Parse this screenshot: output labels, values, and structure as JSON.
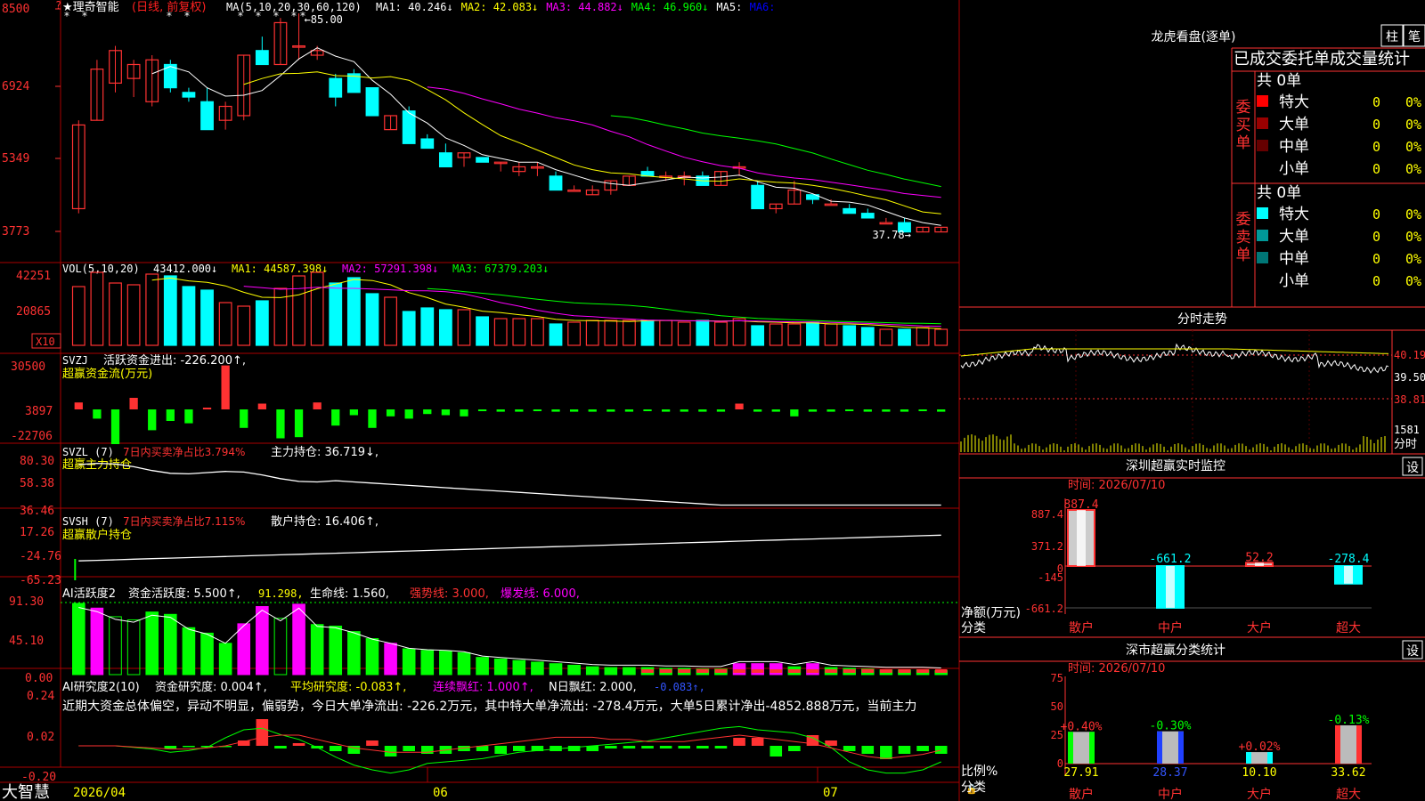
{
  "header": {
    "stock_name": "★理奇智能",
    "period_tag": "(日线, 前复权)",
    "ma_prefix": "MA(5,10,20,30,60,120)",
    "ma_items": [
      {
        "label": "MA1: 40.246↓",
        "color": "#ffffff"
      },
      {
        "label": "MA2: 42.083↓",
        "color": "#ffff00"
      },
      {
        "label": "MA3: 44.882↓",
        "color": "#ff00ff"
      },
      {
        "label": "MA4: 46.960↓",
        "color": "#00ff00"
      },
      {
        "label": "MA5:",
        "color": "#ffffff"
      },
      {
        "label": "MA6:",
        "color": "#0000ff"
      }
    ],
    "high_mark": "85.00",
    "low_mark": "37.78→"
  },
  "main_axis": [
    "8500",
    "6924",
    "5349",
    "3773"
  ],
  "vol": {
    "prefix": "VOL(5,10,20)",
    "value": "43412.000↓",
    "ma1": "MA1: 44587.398↓",
    "ma2": "MA2: 57291.398↓",
    "ma3": "MA3: 67379.203↓",
    "axis": [
      "42251",
      "20865"
    ],
    "unit": "X10"
  },
  "svzj": {
    "prefix": "SVZJ",
    "label": "活跃资金进出: -226.200↑,",
    "sub": "超赢资金流(万元)",
    "axis": [
      "30500",
      "3897",
      "-22706"
    ]
  },
  "svzl": {
    "prefix": "SVZL (7)",
    "label1": "7日内买卖净占比3.794%",
    "label2": "主力持仓: 36.719↓,",
    "sub": "超赢主力持仓",
    "axis": [
      "80.30",
      "58.38",
      "36.46"
    ]
  },
  "svsh": {
    "prefix": "SVSH (7)",
    "label1": "7日内买卖净占比7.115%",
    "label2": "散户持仓: 16.406↑,",
    "sub": "超赢散户持仓",
    "axis": [
      "17.26",
      "-24.76",
      "-65.23"
    ]
  },
  "ai1": {
    "prefix": "AI活跃度2",
    "label1": "资金活跃度: 5.500↑,",
    "label2": "91.298,",
    "label3": "生命线: 1.560,",
    "label4": "强势线: 3.000,",
    "label5": "爆发线: 6.000,",
    "axis": [
      "91.30",
      "45.10",
      "0.00"
    ]
  },
  "ai2": {
    "prefix": "AI研究度2(10)",
    "label1": "资金研究度: 0.004↑,",
    "label2": "平均研究度: -0.083↑,",
    "label3": "连续飘红: 1.000↑,",
    "label4": "N日飘红: 2.000,",
    "label5": "-0.083↑,",
    "commentary": "近期大资金总体偏空，异动不明显，偏弱势，今日大单净流出: -226.2万元，其中特大单净流出: -278.4万元，大单5日累计净出-4852.888万元，当前主力",
    "axis": [
      "0.24",
      "0.02",
      "-0.20"
    ]
  },
  "bottom_bar": {
    "brand": "大智慧",
    "dates": [
      "2026/04",
      "06",
      "07"
    ]
  },
  "right": {
    "title": "龙虎看盘(逐单)",
    "tab1": "柱",
    "tab2": "笔",
    "table_header": "已成交委托单成交量统计",
    "buy": {
      "side_label": "委买单",
      "total": "共 0单",
      "rows": [
        {
          "name": "特大",
          "val": "0",
          "pct": "0%",
          "color": "#ff0000"
        },
        {
          "name": "大单",
          "val": "0",
          "pct": "0%",
          "color": "#990000"
        },
        {
          "name": "中单",
          "val": "0",
          "pct": "0%",
          "color": "#660000"
        },
        {
          "name": "小单",
          "val": "0",
          "pct": "0%",
          "color": "#000000"
        }
      ]
    },
    "sell": {
      "side_label": "委卖单",
      "total": "共 0单",
      "rows": [
        {
          "name": "特大",
          "val": "0",
          "pct": "0%",
          "color": "#00ffff"
        },
        {
          "name": "大单",
          "val": "0",
          "pct": "0%",
          "color": "#009999"
        },
        {
          "name": "中单",
          "val": "0",
          "pct": "0%",
          "color": "#007777"
        },
        {
          "name": "小单",
          "val": "0",
          "pct": "0%",
          "color": "#000000"
        }
      ]
    },
    "intraday": {
      "title": "分时走势",
      "axis": [
        "40.19",
        "39.50",
        "38.81"
      ],
      "vol_axis": [
        "1581"
      ],
      "vol_unit": "分时"
    },
    "monitor": {
      "title": "深圳超赢实时监控",
      "set": "设",
      "time": "时间: 2026/07/10",
      "axis": [
        "887.4",
        "371.2",
        "0",
        "-145",
        "-661.2"
      ],
      "ylabel": "净额(万元)",
      "xlabel": "分类",
      "categories": [
        "散户",
        "中户",
        "大户",
        "超大"
      ],
      "values": [
        "887.4",
        "-661.2",
        "52.2",
        "-278.4"
      ]
    },
    "classify": {
      "title": "深市超赢分类统计",
      "set": "设",
      "time": "时间: 2026/07/10",
      "axis": [
        "75",
        "50",
        "25",
        "0"
      ],
      "ylabel": "比例%",
      "xlabel": "分类",
      "categories": [
        "散户",
        "中户",
        "大户",
        "超大"
      ],
      "changes": [
        "+0.40%",
        "-0.30%",
        "+0.02%",
        "-0.13%"
      ],
      "values": [
        "27.91",
        "28.37",
        "10.10",
        "33.62"
      ]
    }
  },
  "chart_data": [
    {
      "type": "candlestick",
      "title": "★理奇智能",
      "ylabel": "",
      "ylim": [
        37.73,
        85.0
      ],
      "bars": [
        {
          "o": 43,
          "h": 62,
          "l": 42,
          "c": 61
        },
        {
          "o": 62,
          "h": 75,
          "l": 62,
          "c": 73
        },
        {
          "o": 70,
          "h": 78,
          "l": 68,
          "c": 77
        },
        {
          "o": 71,
          "h": 75,
          "l": 67,
          "c": 74
        },
        {
          "o": 66,
          "h": 76,
          "l": 65,
          "c": 75
        },
        {
          "o": 74,
          "h": 75,
          "l": 68,
          "c": 69
        },
        {
          "o": 68,
          "h": 69,
          "l": 66,
          "c": 67
        },
        {
          "o": 66,
          "h": 69,
          "l": 60,
          "c": 60
        },
        {
          "o": 62,
          "h": 66,
          "l": 60,
          "c": 65
        },
        {
          "o": 63,
          "h": 76,
          "l": 62,
          "c": 76
        },
        {
          "o": 77,
          "h": 80,
          "l": 75,
          "c": 74
        },
        {
          "o": 74,
          "h": 84,
          "l": 74,
          "c": 83
        },
        {
          "o": 78,
          "h": 85,
          "l": 75,
          "c": 78
        },
        {
          "o": 76,
          "h": 78,
          "l": 75,
          "c": 77
        },
        {
          "o": 71,
          "h": 72,
          "l": 65,
          "c": 67
        },
        {
          "o": 72,
          "h": 73,
          "l": 68,
          "c": 68
        },
        {
          "o": 69,
          "h": 69,
          "l": 63,
          "c": 63
        },
        {
          "o": 60,
          "h": 63,
          "l": 60,
          "c": 63
        },
        {
          "o": 64,
          "h": 65,
          "l": 57,
          "c": 57
        },
        {
          "o": 58,
          "h": 59,
          "l": 56,
          "c": 56
        },
        {
          "o": 55,
          "h": 57,
          "l": 52,
          "c": 52
        },
        {
          "o": 54,
          "h": 55,
          "l": 52,
          "c": 55
        },
        {
          "o": 54,
          "h": 54,
          "l": 53,
          "c": 53
        },
        {
          "o": 53,
          "h": 53,
          "l": 51,
          "c": 53
        },
        {
          "o": 51,
          "h": 53,
          "l": 50,
          "c": 52
        },
        {
          "o": 52,
          "h": 53,
          "l": 50,
          "c": 52
        },
        {
          "o": 50,
          "h": 51,
          "l": 47,
          "c": 47
        },
        {
          "o": 47,
          "h": 48,
          "l": 47,
          "c": 47
        },
        {
          "o": 46,
          "h": 48,
          "l": 46,
          "c": 47
        },
        {
          "o": 47,
          "h": 49,
          "l": 46,
          "c": 49
        },
        {
          "o": 48,
          "h": 50,
          "l": 48,
          "c": 50
        },
        {
          "o": 51,
          "h": 52,
          "l": 50,
          "c": 50
        },
        {
          "o": 50,
          "h": 51,
          "l": 49,
          "c": 50
        },
        {
          "o": 50,
          "h": 51,
          "l": 48,
          "c": 50
        },
        {
          "o": 50,
          "h": 51,
          "l": 48,
          "c": 48
        },
        {
          "o": 48,
          "h": 51,
          "l": 48,
          "c": 51
        },
        {
          "o": 52,
          "h": 53,
          "l": 50,
          "c": 52
        },
        {
          "o": 48,
          "h": 49,
          "l": 43,
          "c": 43
        },
        {
          "o": 43,
          "h": 44,
          "l": 42,
          "c": 44
        },
        {
          "o": 44,
          "h": 49,
          "l": 44,
          "c": 47
        },
        {
          "o": 46,
          "h": 46,
          "l": 44,
          "c": 45
        },
        {
          "o": 44,
          "h": 45,
          "l": 44,
          "c": 44
        },
        {
          "o": 43,
          "h": 44,
          "l": 42,
          "c": 42
        },
        {
          "o": 42,
          "h": 43,
          "l": 41,
          "c": 41
        },
        {
          "o": 40,
          "h": 41,
          "l": 40,
          "c": 40
        },
        {
          "o": 40,
          "h": 41,
          "l": 38,
          "c": 38
        },
        {
          "o": 38,
          "h": 39,
          "l": 38,
          "c": 39
        },
        {
          "o": 38,
          "h": 39,
          "l": 38,
          "c": 39
        }
      ]
    },
    {
      "type": "bar",
      "title": "VOL(5,10,20)",
      "values": [
        33,
        41,
        35,
        34,
        40,
        39,
        33,
        31,
        24,
        22,
        25,
        32,
        39,
        41,
        35,
        38,
        29,
        27,
        19,
        21,
        20,
        20,
        16,
        15,
        15,
        15,
        12,
        13,
        14,
        14,
        14,
        14,
        14,
        13,
        14,
        13,
        15,
        11,
        12,
        12,
        13,
        12,
        11,
        10,
        9,
        9,
        10,
        9,
        8,
        8
      ],
      "ylim": [
        0,
        44
      ]
    }
  ]
}
